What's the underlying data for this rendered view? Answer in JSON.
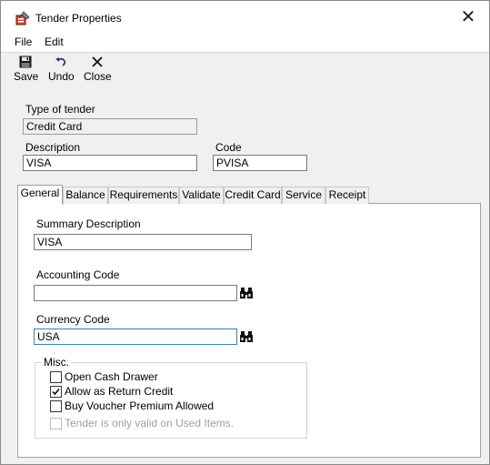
{
  "window": {
    "title": "Tender Properties"
  },
  "menu": {
    "items": [
      "File",
      "Edit"
    ]
  },
  "toolbar": {
    "save_label": "Save",
    "undo_label": "Undo",
    "close_label": "Close"
  },
  "header": {
    "type_of_tender_label": "Type of tender",
    "type_of_tender_value": "Credit Card",
    "description_label": "Description",
    "description_value": "VISA",
    "code_label": "Code",
    "code_value": "PVISA"
  },
  "tabs": [
    "General",
    "Balance",
    "Requirements",
    "Validate",
    "Credit Card",
    "Service",
    "Receipt"
  ],
  "active_tab": "General",
  "general": {
    "summary_label": "Summary Description",
    "summary_value": "VISA",
    "accounting_label": "Accounting Code",
    "accounting_value": "",
    "currency_label": "Currency Code",
    "currency_value": "USA",
    "misc_label": "Misc.",
    "checkboxes": [
      {
        "label": "Open Cash Drawer",
        "checked": false,
        "enabled": true
      },
      {
        "label": "Allow as Return Credit",
        "checked": true,
        "enabled": true
      },
      {
        "label": "Buy Voucher Premium Allowed",
        "checked": false,
        "enabled": true
      },
      {
        "label": "Tender is only valid on Used Items.",
        "checked": false,
        "enabled": false
      }
    ]
  }
}
